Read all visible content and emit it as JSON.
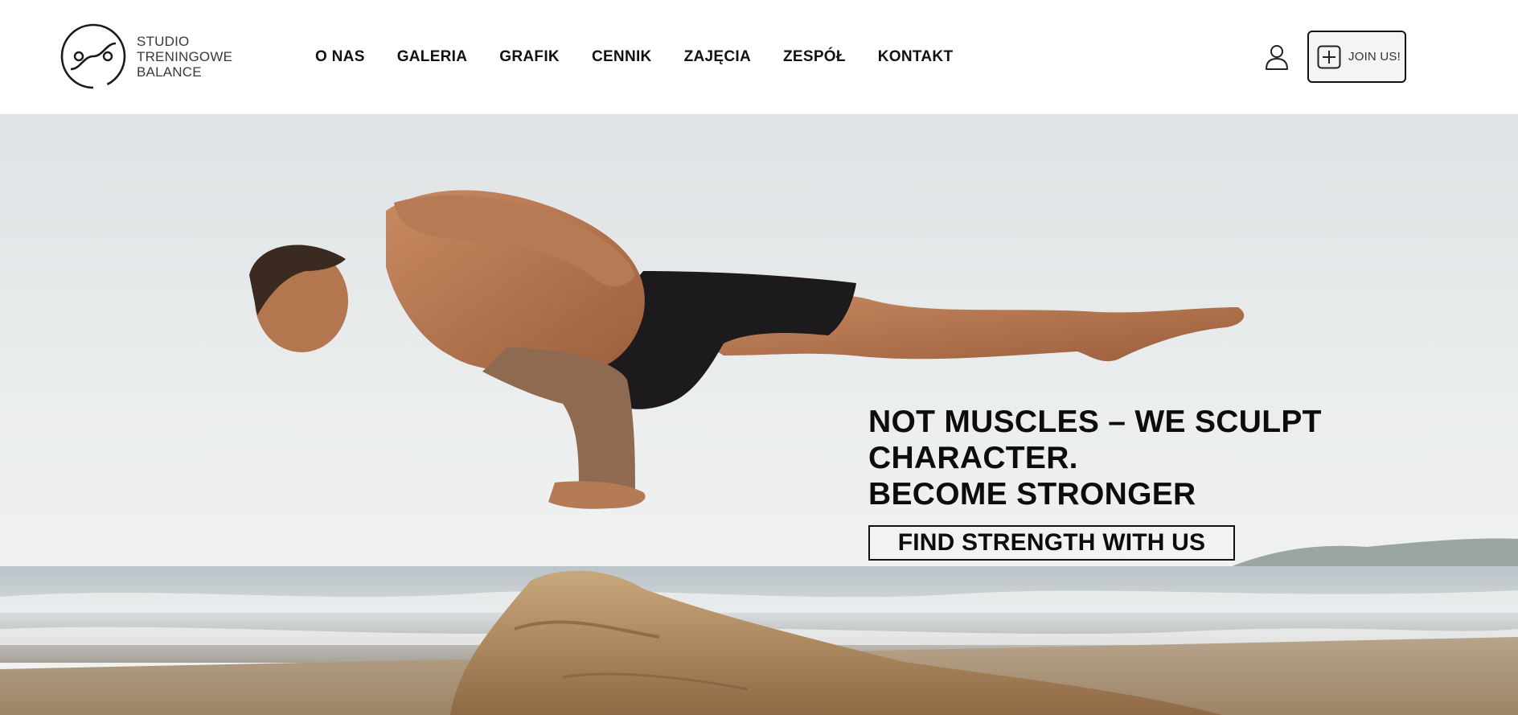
{
  "brand": {
    "line1": "STUDIO",
    "line2": "TRENINGOWE",
    "line3": "BALANCE"
  },
  "nav": {
    "items": [
      {
        "label": "O NAS"
      },
      {
        "label": "GALERIA"
      },
      {
        "label": "GRAFIK"
      },
      {
        "label": "CENNIK"
      },
      {
        "label": "ZAJĘCIA"
      },
      {
        "label": "ZESPÓŁ"
      },
      {
        "label": "KONTAKT"
      }
    ]
  },
  "header": {
    "join_label": "JOIN US!",
    "user_icon": "user-icon",
    "join_icon": "plus-square-icon"
  },
  "hero": {
    "headline_line1": "NOT MUSCLES – WE SCULPT CHARACTER.",
    "headline_line2": "BECOME STRONGER",
    "cta_label": "FIND STRENGTH WITH US",
    "image_subject": "man balancing on one arm on driftwood at the beach"
  },
  "colors": {
    "text": "#0c0c0c",
    "background": "#ffffff",
    "button_bg": "#f4f4f4"
  }
}
